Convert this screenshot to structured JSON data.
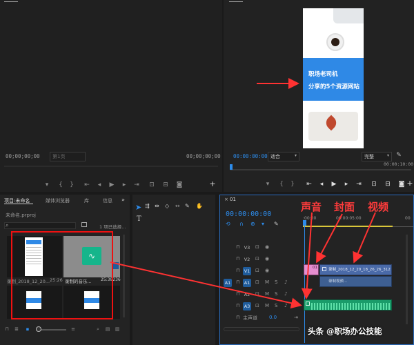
{
  "source": {
    "tc_left": "00;00;00;00",
    "tc_right": "00;00;00;00",
    "page_select": "第1页",
    "colors": {
      "accent": "#2d8ceb"
    }
  },
  "program": {
    "tc_left": "00:00:00:00",
    "fit_select": "适合",
    "quality_select": "完整",
    "tc_right": "00:00:10:00",
    "card_title": "职场老司机",
    "card_subtitle": "分享的5个资源网站"
  },
  "project": {
    "tabs": [
      "项目:未命名",
      "媒体浏览器",
      "库",
      "信息"
    ],
    "filename": "未命名.prproj",
    "selection_info": "1 项已选择...",
    "clips": [
      {
        "name": "录制_2018_12_20...",
        "duration": "25:26"
      },
      {
        "name": "录制的音乐...",
        "duration": "25:38236"
      }
    ]
  },
  "timeline": {
    "tab": "01",
    "timecode": "00:00:00:00",
    "ruler_start": ":00:00",
    "ruler_mid": "00:00:05:00",
    "ruler_end": "00",
    "video_tracks": [
      "V3",
      "V2",
      "V1"
    ],
    "audio_tracks": [
      "A1",
      "A2",
      "A3"
    ],
    "source_patch": "A1",
    "master_label": "主声道",
    "master_value": "0.0",
    "clip_v1_label": "录制_2018_12_20_18_26_26_312.m",
    "clip_v1_badge": "01",
    "clip_a_label": "录制视频...",
    "icons": [
      "play-icon",
      "pen-icon",
      "hand-icon",
      "text-icon",
      "wrench-icon",
      "camera-icon"
    ]
  },
  "annotations": {
    "sound": "声音",
    "cover": "封面",
    "video": "视频"
  },
  "watermark": {
    "text": "头条 @职场办公技能"
  }
}
